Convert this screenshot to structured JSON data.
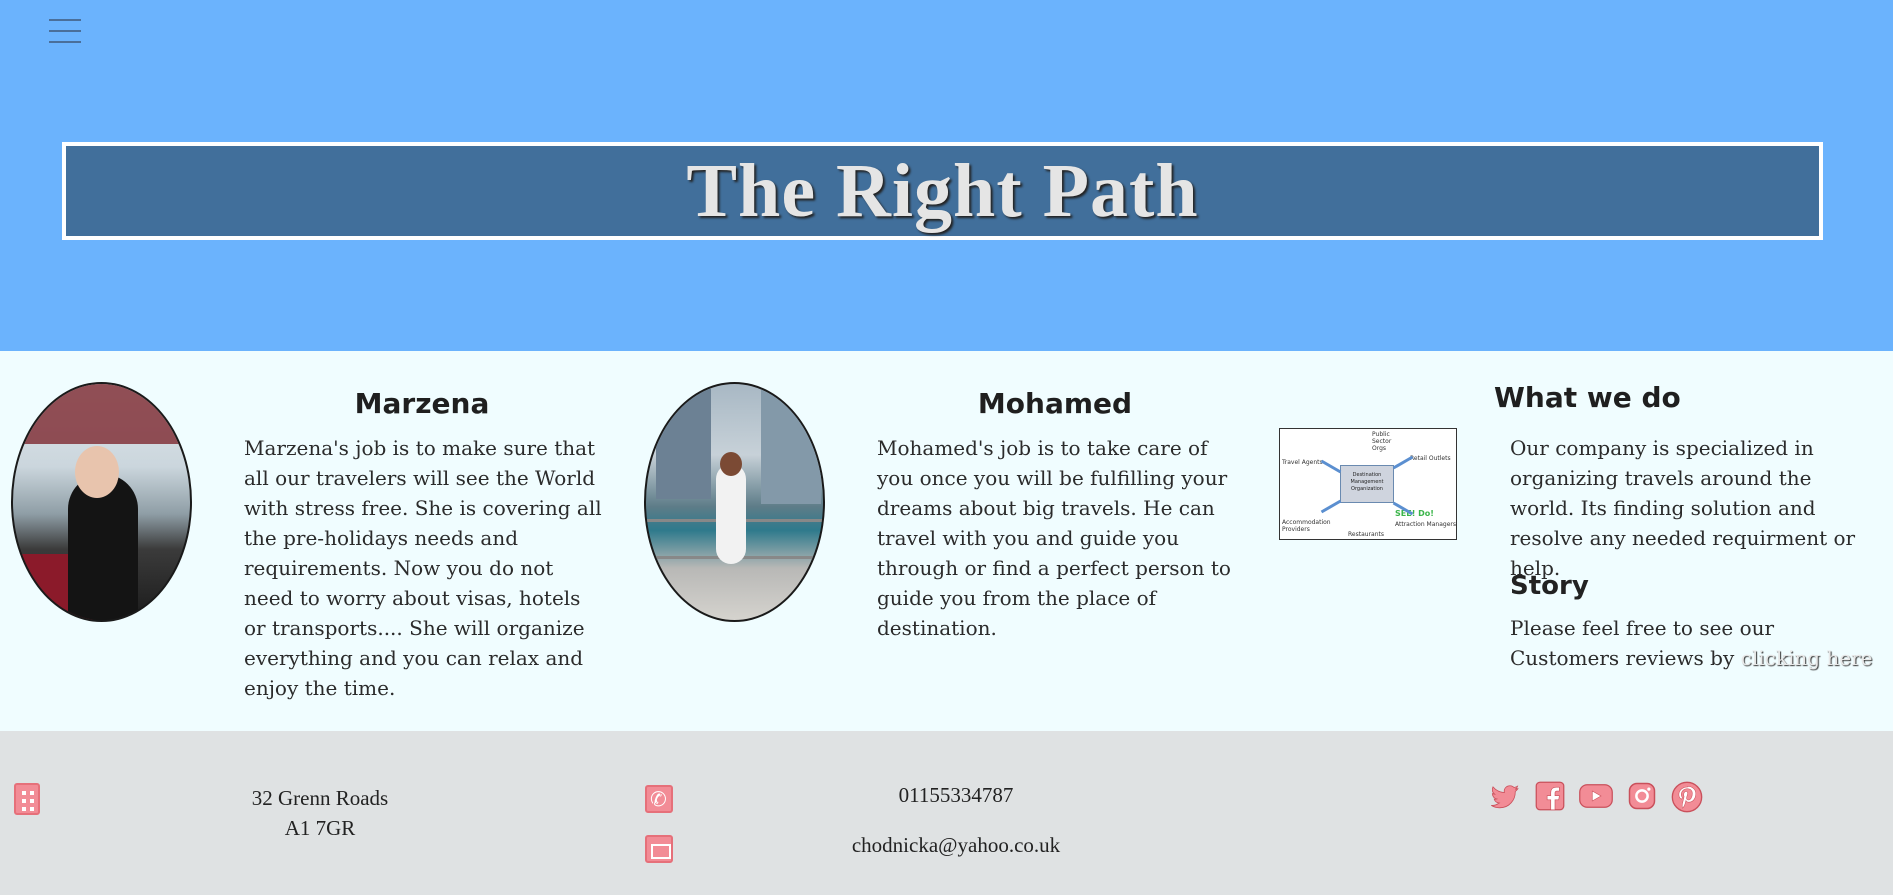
{
  "header": {
    "title": "The Right Path",
    "menu_icon": "hamburger-menu-icon"
  },
  "team": [
    {
      "name": "Marzena",
      "bio": "Marzena's job is to make sure that all our travelers will see the World with stress free. She is covering all the pre-holidays needs and requirements. Now you do not need to worry about visas, hotels or transports.... She will organize everything and you can relax and enjoy the time."
    },
    {
      "name": "Mohamed",
      "bio": "Mohamed's job is to take care of you once you will be fulfilling your dreams about big travels. He can travel with you and guide you through or find a perfect person to guide you from the place of destination."
    }
  ],
  "diagram": {
    "center": "Destination Management Organization",
    "nodes": [
      "Travel Agents",
      "Public Sector Orgs",
      "Retail Outlets",
      "Accommodation Providers",
      "Restaurants",
      "Attraction Managers",
      "SEE! Do!"
    ]
  },
  "what_we_do": {
    "title": "What we do",
    "text": "Our company is specialized in organizing travels around the world. Its finding solution and resolve any needed requirment or help.",
    "story_title": "Story",
    "story_text": "Please feel free to see our Customers reviews by",
    "story_link": "clicking here"
  },
  "footer": {
    "address_line1": "32 Grenn Roads",
    "address_line2": "A1 7GR",
    "phone": "01155334787",
    "email": "chodnicka@yahoo.co.uk",
    "social": [
      "twitter-icon",
      "facebook-icon",
      "youtube-icon",
      "instagram-icon",
      "pinterest-icon"
    ],
    "icon_color": "#f28c96"
  },
  "colors": {
    "hero_bg": "#6bb3fd",
    "title_bg": "#416f9b",
    "main_bg": "#f0fdff",
    "footer_bg": "#dfe2e3"
  }
}
